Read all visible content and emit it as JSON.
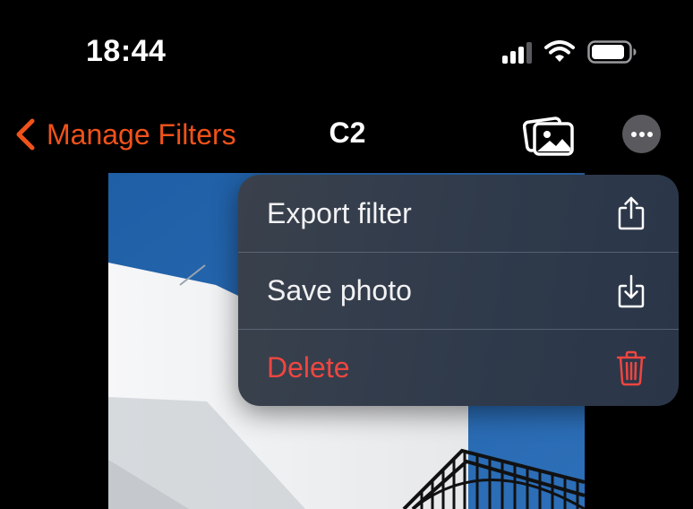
{
  "status_bar": {
    "time": "18:44",
    "icons": [
      "cellular-signal-icon",
      "wifi-icon",
      "battery-icon"
    ]
  },
  "nav": {
    "back_label": "Manage Filters",
    "title": "C2",
    "accent_color": "#f0521a",
    "right_buttons": [
      "photo-gallery-icon",
      "more-options-icon"
    ]
  },
  "menu": {
    "items": [
      {
        "label": "Export filter",
        "icon": "share-icon",
        "color": "#f2f2f4"
      },
      {
        "label": "Save photo",
        "icon": "download-icon",
        "color": "#f2f2f4"
      },
      {
        "label": "Delete",
        "icon": "trash-icon",
        "color": "#ef4640"
      }
    ]
  }
}
